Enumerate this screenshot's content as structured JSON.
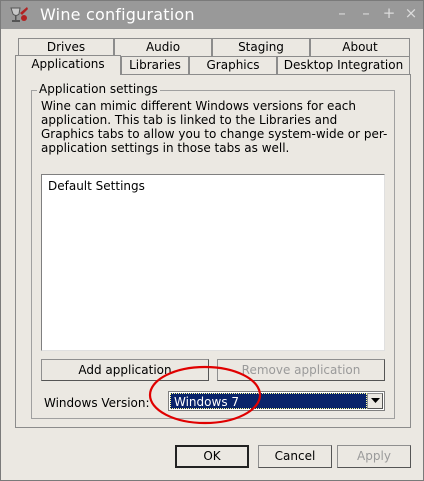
{
  "window": {
    "title": "Wine configuration"
  },
  "titlebar": {
    "app_icon": "wine-glass-icon",
    "buttons": {
      "collapse": "–",
      "minimize": "–",
      "maximize": "+",
      "close": "×"
    }
  },
  "tabs": {
    "row1": [
      "Drives",
      "Audio",
      "Staging",
      "About"
    ],
    "row2": [
      "Applications",
      "Libraries",
      "Graphics",
      "Desktop Integration"
    ],
    "active": "Applications"
  },
  "app_settings": {
    "legend": "Application settings",
    "description": "Wine can mimic different Windows versions for each application. This tab is linked to the Libraries and Graphics tabs to allow you to change system-wide or per-application settings in those tabs as well.",
    "list_items": [
      "Default Settings"
    ],
    "add_button": "Add application",
    "remove_button": "Remove application",
    "version_label": "Windows Version:",
    "version_value": "Windows 7"
  },
  "footer": {
    "ok": "OK",
    "cancel": "Cancel",
    "apply": "Apply"
  },
  "colors": {
    "titlebar": "#999999",
    "selection": "#0a246a",
    "annotation_circle": "#e00000"
  }
}
